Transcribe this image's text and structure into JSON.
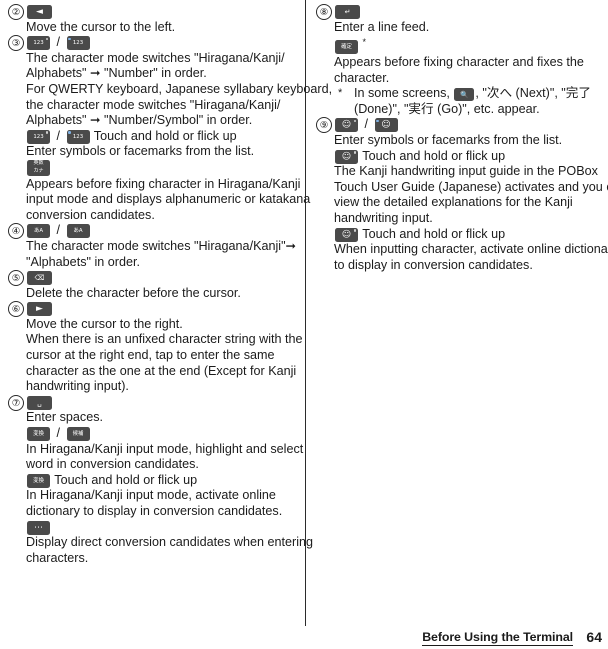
{
  "document": {
    "page_number": "64",
    "footer_section": "Before Using the Terminal"
  },
  "left_column": {
    "items": [
      {
        "number": "②",
        "keys": [
          {
            "name": "cursor-left-key",
            "glyph": "◄"
          }
        ],
        "lines": [
          "Move the cursor to the left."
        ]
      },
      {
        "number": "③",
        "keys": [
          {
            "name": "number-mode-key",
            "glyph": "123"
          },
          {
            "name": "number-symbol-mode-key",
            "glyph": "123"
          }
        ],
        "separator": "/",
        "lines": [
          "The character mode switches \"Hiragana/Kanji/",
          "Alphabets\" ➞ \"Number\" in order.",
          "For QWERTY keyboard, Japanese syllabary keyboard,",
          "the character mode switches \"Hiragana/Kanji/",
          "Alphabets\" ➞ \"Number/Symbol\" in order."
        ],
        "sub_action": "Touch and hold or flick up",
        "sub_lines": [
          "Enter symbols or facemarks from the list."
        ],
        "extra_key": {
          "name": "eiji-kana-key",
          "glyph_top": "英数",
          "glyph_bottom": "カナ"
        },
        "extra_lines": [
          "Appears before fixing character in Hiragana/Kanji",
          "input mode and displays alphanumeric or katakana",
          "conversion candidates."
        ]
      },
      {
        "number": "④",
        "keys": [
          {
            "name": "alphabet-mode-key",
            "glyph": "あA"
          },
          {
            "name": "alphabet-mode-key-alt",
            "glyph": "あA"
          }
        ],
        "separator": "/",
        "lines": [
          "The character mode switches \"Hiragana/Kanji\"➞",
          "\"Alphabets\" in order."
        ]
      },
      {
        "number": "⑤",
        "keys": [
          {
            "name": "backspace-key",
            "glyph": "⌫"
          }
        ],
        "lines": [
          "Delete the character before the cursor."
        ]
      },
      {
        "number": "⑥",
        "keys": [
          {
            "name": "cursor-right-key",
            "glyph": "►"
          }
        ],
        "lines": [
          "Move the cursor to the right.",
          "When there is an unfixed character string with the",
          "cursor at the right end, tap to enter the same",
          "character as the one at the end (Except for Kanji",
          "handwriting input)."
        ]
      },
      {
        "number": "⑦",
        "keys": [
          {
            "name": "space-key",
            "glyph": "␣"
          }
        ],
        "lines": [
          "Enter spaces."
        ],
        "pair_keys": [
          {
            "name": "conversion-key",
            "glyph": "変換"
          },
          {
            "name": "candidate-key",
            "glyph": "候補"
          }
        ],
        "pair_separator": "/",
        "pair_lines": [
          "In Hiragana/Kanji input mode, highlight and select",
          "word in conversion candidates."
        ],
        "hold_key": {
          "name": "conversion-key-hold",
          "glyph": "変換"
        },
        "hold_action": "Touch and hold or flick up",
        "hold_lines": [
          "In Hiragana/Kanji input mode, activate online",
          "dictionary to display in conversion candidates."
        ],
        "last_key": {
          "name": "direct-conversion-key",
          "glyph": "⋯"
        },
        "last_lines": [
          "Display direct conversion candidates when entering",
          "characters."
        ]
      }
    ]
  },
  "right_column": {
    "items": [
      {
        "number": "⑧",
        "keys": [
          {
            "name": "line-feed-key",
            "glyph": "↵"
          }
        ],
        "lines": [
          "Enter a line feed."
        ],
        "second_key": {
          "name": "fix-character-key",
          "glyph": "確定"
        },
        "second_key_star": "*",
        "second_lines": [
          "Appears before fixing character and fixes the",
          "character."
        ],
        "note": {
          "asterisk": "*",
          "prefix": "In some screens, ",
          "inline_key": {
            "name": "search-key",
            "glyph": "🔍"
          },
          "suffix": ", \"次へ (Next)\", \"完了",
          "line2": "(Done)\", \"実行 (Go)\", etc. appear."
        }
      },
      {
        "number": "⑨",
        "keys": [
          {
            "name": "facemark-key",
            "glyph": "☺"
          },
          {
            "name": "facemark-key-alt",
            "glyph": "☺"
          }
        ],
        "separator": "/",
        "lines": [
          "Enter symbols or facemarks from the list."
        ],
        "hold_key": {
          "name": "facemark-key-hold",
          "glyph": "☺"
        },
        "hold_action": "Touch and hold or flick up",
        "hold_lines": [
          "The Kanji handwriting input guide in the POBox",
          "Touch User Guide (Japanese) activates and you can",
          "view the detailed explanations for the Kanji",
          "handwriting input."
        ],
        "hold_key2": {
          "name": "facemark-key-hold-2",
          "glyph": "☺"
        },
        "hold_action2": "Touch and hold or flick up",
        "hold_lines2": [
          "When inputting character, activate online dictionary",
          "to display in conversion candidates."
        ]
      }
    ]
  }
}
